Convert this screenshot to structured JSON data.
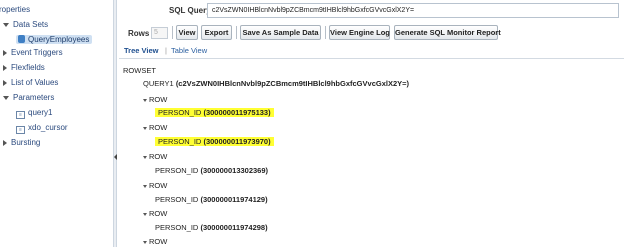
{
  "sidebar": {
    "items": [
      {
        "label": "roperties",
        "expander": "none"
      },
      {
        "label": "Data Sets",
        "expander": "down"
      },
      {
        "label": "QueryEmployees",
        "expander": "none"
      },
      {
        "label": "Event Triggers",
        "expander": "right"
      },
      {
        "label": "Flexfields",
        "expander": "right"
      },
      {
        "label": "List of Values",
        "expander": "right"
      },
      {
        "label": "Parameters",
        "expander": "down"
      },
      {
        "label": "query1",
        "expander": "none"
      },
      {
        "label": "xdo_cursor",
        "expander": "none"
      },
      {
        "label": "Bursting",
        "expander": "right"
      }
    ]
  },
  "query": {
    "label": "SQL Query",
    "value": "c2VsZWN0IHBlcnNvbl9pZCBmcm9tIHBlcl9hbGxfcGVvcGxlX2Y="
  },
  "toolbar": {
    "rows_label": "Rows",
    "rows_value": "5",
    "view_label": "View",
    "export_label": "Export",
    "save_sample_label": "Save As Sample Data",
    "view_engine_log_label": "View Engine Log",
    "generate_sql_monitor_label": "Generate SQL Monitor Report"
  },
  "tabs": {
    "tree_view": "Tree View",
    "separator": "|",
    "table_view": "Table View"
  },
  "tree": {
    "rowset": "ROWSET",
    "query_label": "QUERY1",
    "query_id": "(c2VsZWN0IHBlcnNvbl9pZCBmcm9tIHBlcl9hbGxfcGVvcGxlX2Y=)",
    "rows": [
      {
        "row_label": "ROW",
        "field_label": "PERSON_ID",
        "value": "(300000011975133)",
        "highlighted": true
      },
      {
        "row_label": "ROW",
        "field_label": "PERSON_ID",
        "value": "(300000011973970)",
        "highlighted": true
      },
      {
        "row_label": "ROW",
        "field_label": "PERSON_ID",
        "value": "(300000013302369)",
        "highlighted": false
      },
      {
        "row_label": "ROW",
        "field_label": "PERSON_ID",
        "value": "(300000011974129)",
        "highlighted": false
      },
      {
        "row_label": "ROW",
        "field_label": "PERSON_ID",
        "value": "(300000011974298)",
        "highlighted": false
      },
      {
        "row_label": "ROW"
      }
    ],
    "highlight_color": "#ffff33"
  }
}
